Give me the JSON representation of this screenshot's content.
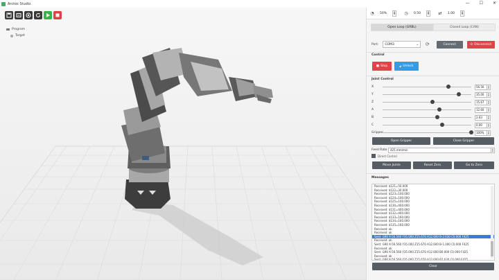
{
  "app": {
    "title": "Arctos Studio",
    "window_controls": [
      "—",
      "☐",
      "✕"
    ]
  },
  "toolbar": {
    "buttons": [
      "save-icon",
      "open-icon",
      "target-icon",
      "refresh-icon",
      "play-icon",
      "stop-icon"
    ]
  },
  "tree": {
    "root": "Program",
    "child": "Target"
  },
  "topbar": {
    "speed": "50%",
    "accel": "0.50",
    "step": "1.00"
  },
  "tabs": {
    "open_loop": "Open Loop (GRBL)",
    "closed_loop": "Closed Loop (CAN)"
  },
  "port": {
    "label": "Port:",
    "value": "COM3",
    "connect": "Connect",
    "disconnect": "Disconnect"
  },
  "control": {
    "label": "Control",
    "stop": "Stop",
    "unlock": "Unlock"
  },
  "joint_control": {
    "label": "Joint Control",
    "joints": [
      {
        "name": "X",
        "value": "56.56",
        "level": 0.74
      },
      {
        "name": "Y",
        "value": "35.00",
        "level": 0.86
      },
      {
        "name": "Z",
        "value": "15.67",
        "level": 0.56
      },
      {
        "name": "A",
        "value": "12.60",
        "level": 0.64
      },
      {
        "name": "B",
        "value": "2.63",
        "level": 0.62
      },
      {
        "name": "C",
        "value": "0.00",
        "level": 0.67
      }
    ],
    "gripper": {
      "name": "Gripper",
      "value": "100%",
      "level": 1.0
    }
  },
  "grip_buttons": {
    "open": "Open Gripper",
    "close": "Close Gripper"
  },
  "feed": {
    "label": "Feed Rate",
    "value": "425 mm/min"
  },
  "direct_control": "Direct Control",
  "action_buttons": {
    "move_joints": "Move Joints",
    "reset_zero": "Reset Zero",
    "go_to_zero": "Go to Zero"
  },
  "messages": {
    "label": "Messages",
    "lines": [
      "Received: $121=50.000",
      "Received: $122=30.000",
      "Received: $123=100.000",
      "Received: $124=100.000",
      "Received: $125=100.000",
      "Received: $130=400.000",
      "Received: $131=400.000",
      "Received: $132=400.000",
      "Received: $133=160.000",
      "Received: $134=160.000",
      "Received: $135=160.000",
      "Received: ok",
      "Received: ok",
      "Sent: G90 X-56.560 Y35.000 Z15.670 A12.600 B-2.630 C0.000 F425",
      "Received: ok",
      "Sent: G90 X-56.560 Y35.000 Z15.670 A12.600 B-1.000 C0.000 F425",
      "Received: ok",
      "Sent: G90 X-56.560 Y35.000 Z15.670 A12.600 B0.000 C0.000 F425",
      "Received: ok",
      "Sent: G90 X-56.560 Y35.000 Z15.670 A12.600 B2.630 C0.000 F425",
      "Received: ok"
    ],
    "highlight_index": 13,
    "clear": "Clear"
  }
}
